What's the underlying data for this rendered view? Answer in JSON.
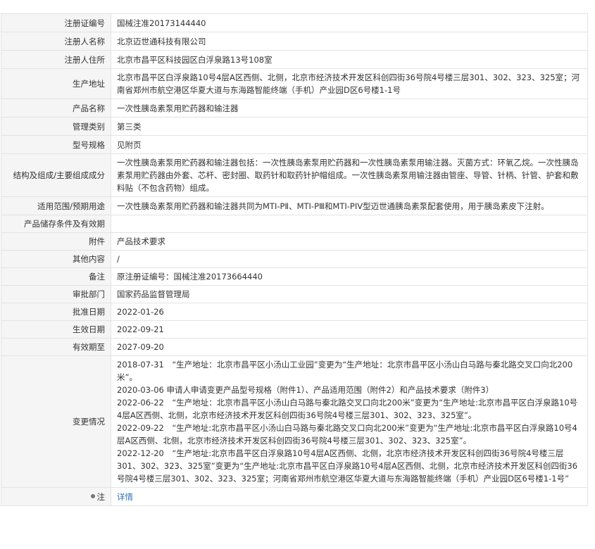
{
  "rows": [
    {
      "label": "注册证编号",
      "value": "国械注准20173144440"
    },
    {
      "label": "注册人名称",
      "value": "北京迈世通科技有限公司"
    },
    {
      "label": "注册人住所",
      "value": "北京市昌平区科技园区白浮泉路13号108室"
    },
    {
      "label": "生产地址",
      "value": "北京市昌平区白浮泉路10号4层A区西侧、北侧，北京市经济技术开发区科创四街36号院4号楼三层301、302、323、325室；河南省郑州市航空港区华夏大道与东海路智能终端（手机）产业园D区6号楼1-1号"
    },
    {
      "label": "产品名称",
      "value": "一次性胰岛素泵用贮药器和输注器"
    },
    {
      "label": "管理类别",
      "value": "第三类"
    },
    {
      "label": "型号规格",
      "value": "见附页"
    },
    {
      "label": "结构及组成/主要组成成分",
      "value": "一次性胰岛素泵用贮药器和输注器包括：一次性胰岛素泵用贮药器和一次性胰岛素泵用输注器。灭菌方式：环氧乙烷。一次性胰岛素泵用贮药器由外套、芯杆、密封圈、取药针和取药针护帽组成。一次性胰岛素泵用输注器由管座、导管、针柄、针管、护套和敷料贴（不包含药物）组成。"
    },
    {
      "label": "适用范围/预期用途",
      "value": "一次性胰岛素泵用贮药器和输注器共同为MTI-PⅡ、MTI-PⅢ和MTI-PIV型迈世通胰岛素泵配套使用，用于胰岛素皮下注射。"
    },
    {
      "label": "产品储存条件及有效期",
      "value": ""
    },
    {
      "label": "附件",
      "value": "产品技术要求"
    },
    {
      "label": "其他内容",
      "value": "/"
    },
    {
      "label": "备注",
      "value": "原注册证编号：国械注准20173664440"
    },
    {
      "label": "审批部门",
      "value": "国家药品监督管理局"
    },
    {
      "label": "批准日期",
      "value": "2022-01-26"
    },
    {
      "label": "生效日期",
      "value": "2022-09-21"
    },
    {
      "label": "有效期至",
      "value": "2027-09-20"
    }
  ],
  "history": {
    "label": "变更情况",
    "entries": [
      "2018-07-31　“生产地址：北京市昌平区小汤山工业园”变更为“生产地址：北京市昌平区小汤山白马路与秦北路交叉口向北200米”。",
      "2020-03-06 申请人申请变更产品型号规格（附件1）、产品适用范围（附件2）和产品技术要求（附件3）",
      "2022-06-22　“生产地址：北京市昌平区小汤山白马路与秦北路交叉口向北200米”变更为“生产地址:北京市昌平区白浮泉路10号4层A区西侧、北侧，北京市经济技术开发区科创四街36号院4号楼三层301、302、323、325室”。",
      "2022-09-22　“生产地址:北京市昌平区小汤山白马路与秦北路交叉口向北200米”变更为“生产地址:北京市昌平区白浮泉路10号4层A区西侧、北侧，北京市经济技术开发区科创四街36号院4号楼三层301、302、323、325室”。",
      "2022-12-20　“生产地址:北京市昌平区白浮泉路10号4层A区西侧、北侧，北京市经济技术开发区科创四街36号院4号楼三层 301、302、323、325室”变更为“生产地址:北京市昌平区白浮泉路10号4层A区西侧、北侧，北京市经济技术开发区科创四街36号院4号楼三层301、302、323、325室；河南省郑州市航空港区华夏大道与东海路智能终端（手机）产业园D区6号楼1-1号”"
    ]
  },
  "note": {
    "label": "注",
    "link": "详情"
  }
}
